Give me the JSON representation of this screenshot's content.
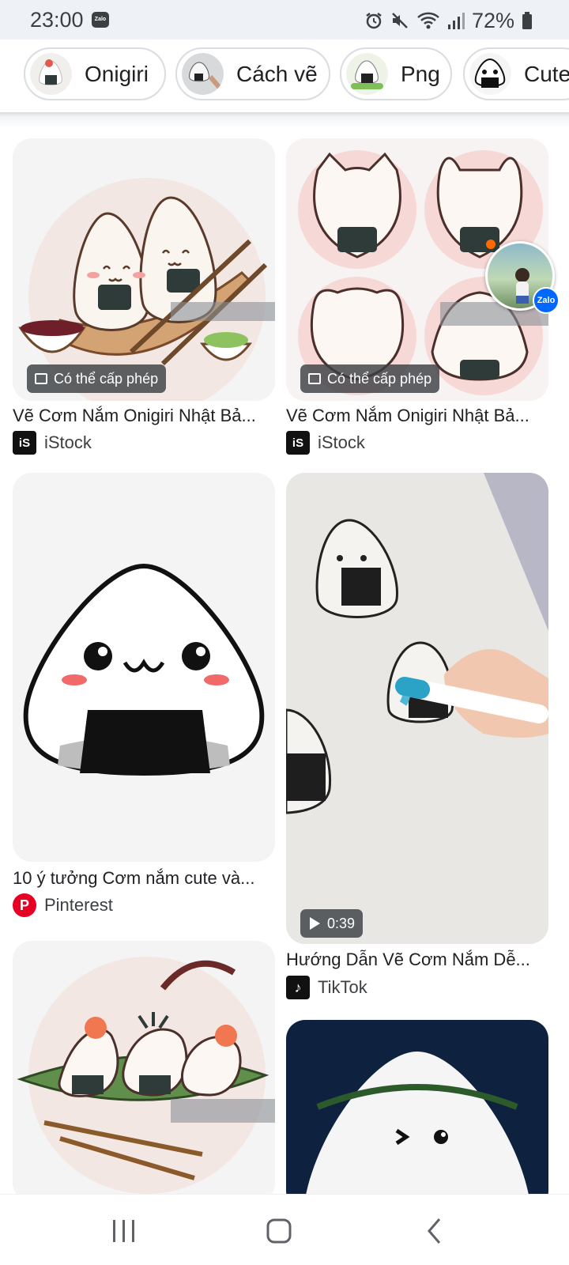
{
  "status_bar": {
    "time": "23:00",
    "battery": "72%",
    "icons": [
      "zalo-notification-icon",
      "alarm-icon",
      "mute-icon",
      "wifi-icon",
      "signal-icon",
      "battery-icon"
    ]
  },
  "chips": [
    {
      "label": "Onigiri"
    },
    {
      "label": "Cách vẽ"
    },
    {
      "label": "Png"
    },
    {
      "label": "Cute"
    }
  ],
  "results": {
    "col1": [
      {
        "title": "Vẽ Cơm Nắm Onigiri Nhật Bả...",
        "source": "iStock",
        "badge": "Có thể cấp phép"
      },
      {
        "title": "10 ý tưởng Cơm nắm cute và...",
        "source": "Pinterest"
      },
      {
        "title": "",
        "source": ""
      }
    ],
    "col2": [
      {
        "title": "Vẽ Cơm Nắm Onigiri Nhật Bả...",
        "source": "iStock",
        "badge": "Có thể cấp phép"
      },
      {
        "title": "Hướng Dẫn Vẽ Cơm Nắm Dễ...",
        "source": "TikTok",
        "duration": "0:39"
      },
      {
        "title": "",
        "source": ""
      }
    ]
  },
  "floating_bubble": {
    "app": "Zalo"
  },
  "colors": {
    "status_bg": "#eef1f6",
    "badge_bg": "#3c4043",
    "pinterest": "#e60023",
    "zalo": "#0068ff",
    "nori": "#2f3b38"
  },
  "nav": [
    "recent-apps-icon",
    "home-icon",
    "back-icon"
  ]
}
